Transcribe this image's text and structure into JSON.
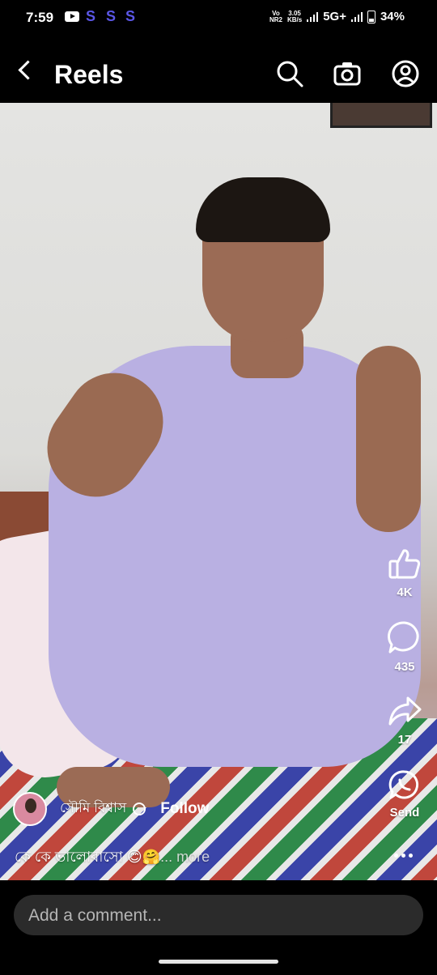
{
  "status_bar": {
    "time": "7:59",
    "letters": [
      "S",
      "S",
      "S"
    ],
    "net_top": "Vo",
    "net_bottom": "NR2",
    "speed_value": "3.05",
    "speed_unit": "KB/s",
    "net_type": "5G+",
    "battery": "34%",
    "accent_color": "#5b57e6"
  },
  "header": {
    "title": "Reels",
    "icons": [
      "back-icon",
      "search-icon",
      "camera-icon",
      "profile-icon"
    ]
  },
  "actions": {
    "like_count": "4K",
    "comment_count": "435",
    "share_count": "17",
    "send_label": "Send"
  },
  "creator": {
    "name": "সৌমি বিশ্বাস",
    "follow_label": "Follow"
  },
  "caption": {
    "text": "কে কে ভালোবাসো 😊🤗",
    "more_label": "... more"
  },
  "comment_box": {
    "placeholder": "Add a comment..."
  }
}
